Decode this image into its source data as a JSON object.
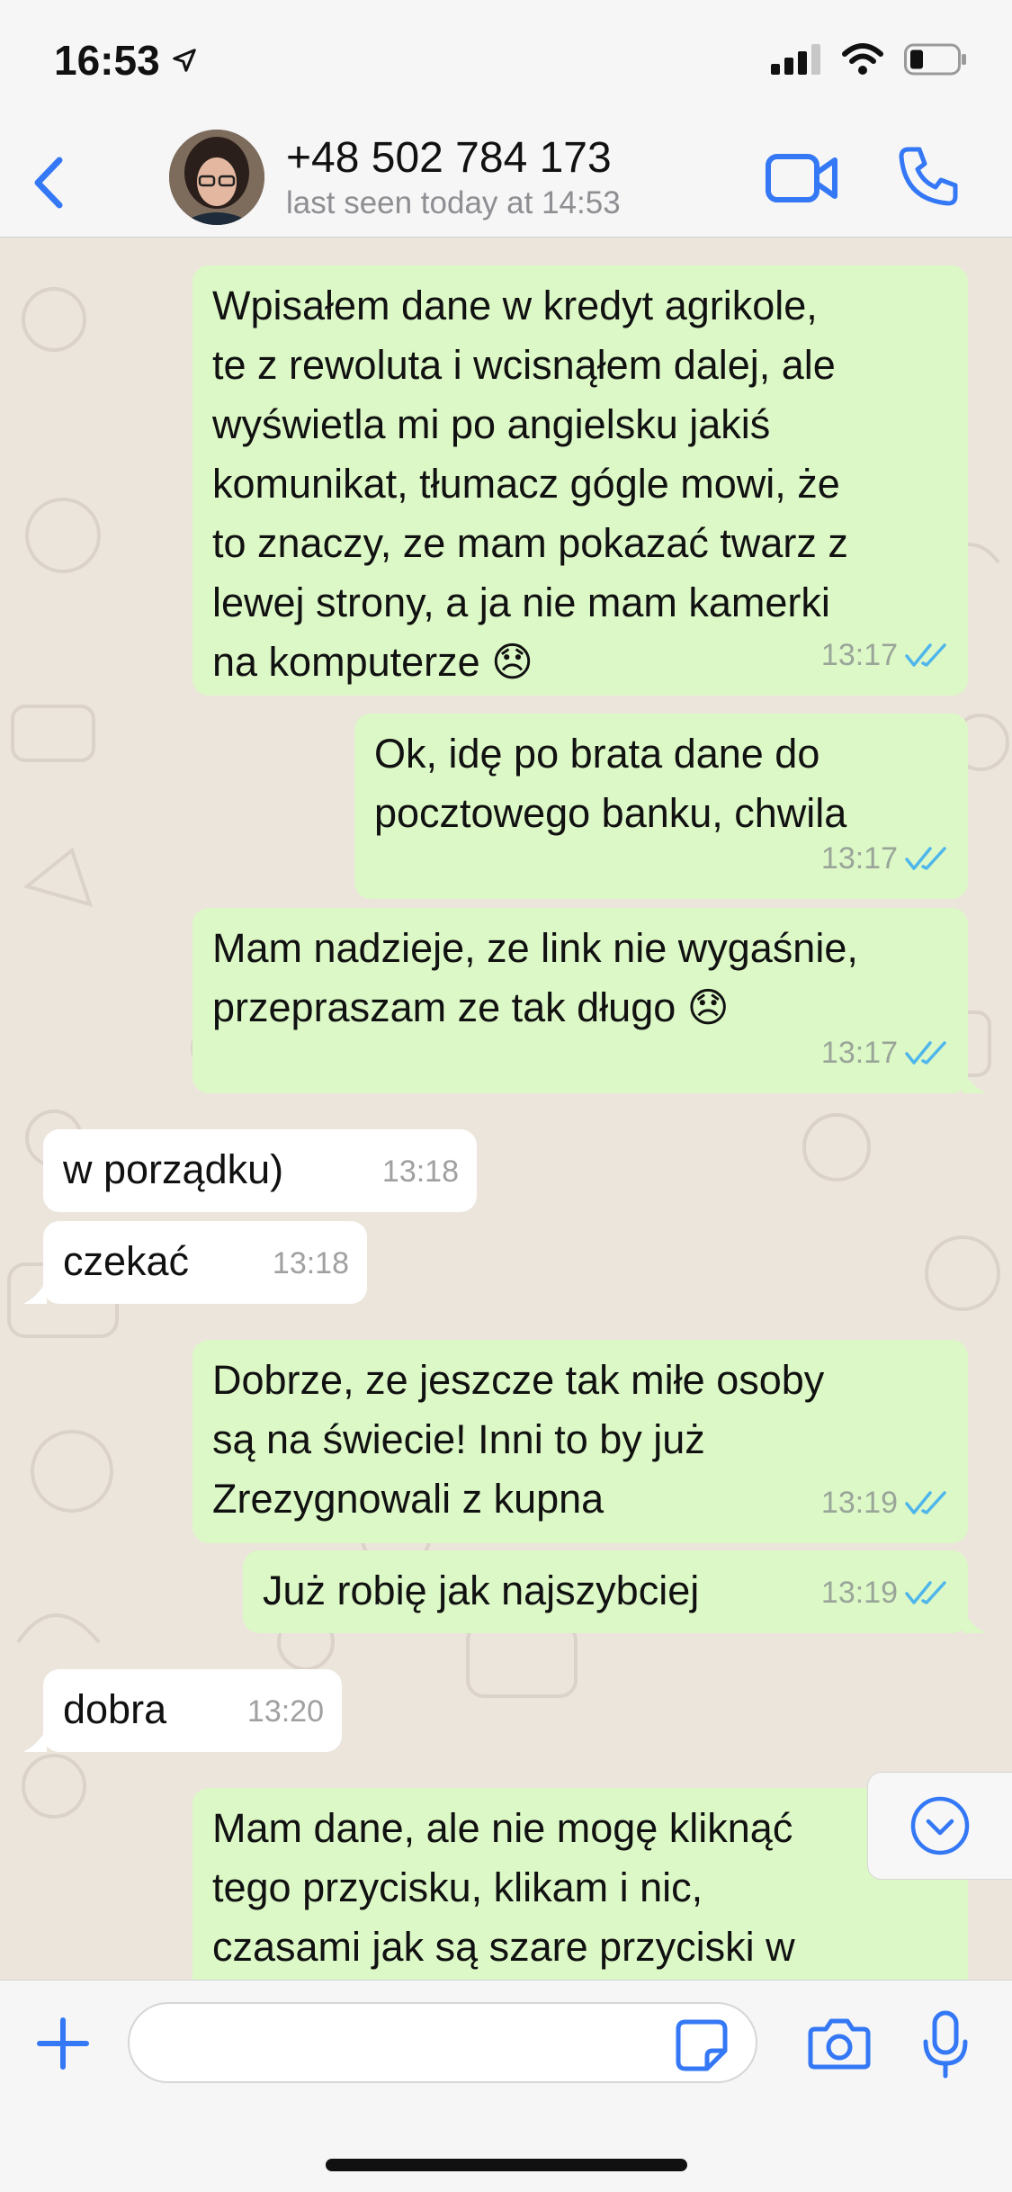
{
  "status_bar": {
    "time": "16:53",
    "icons": [
      "location-arrow-icon",
      "signal-icon",
      "wifi-icon",
      "battery-icon"
    ]
  },
  "header": {
    "contact_name": "+48 502 784 173",
    "last_seen": "last seen today at 14:53",
    "icons": [
      "back-chevron-icon",
      "video-call-icon",
      "phone-call-icon"
    ]
  },
  "messages": [
    {
      "direction": "out",
      "text": "Wpisałem dane w kredyt agrikole,\nte z rewoluta i wcisnąłem dalej, ale\nwyświetla mi po angielsku jakiś\nkomunikat, tłumacz gógle mowi, że\nto znaczy, ze mam pokazać twarz z\nlewej strony, a ja nie mam kamerki\nna komputerze 😞",
      "time": "13:17",
      "read": true
    },
    {
      "direction": "out",
      "text": "Ok, idę po brata dane do\npocztowego banku, chwila",
      "time": "13:17",
      "read": true
    },
    {
      "direction": "out",
      "text": "Mam nadzieje, ze link nie wygaśnie,\nprzepraszam ze tak długo 😞",
      "time": "13:17",
      "read": true
    },
    {
      "direction": "in",
      "text": "w porządku)",
      "time": "13:18"
    },
    {
      "direction": "in",
      "text": "czekać",
      "time": "13:18"
    },
    {
      "direction": "out",
      "text": "Dobrze, ze jeszcze tak miłe osoby\nsą na świecie! Inni to by już\nZrezygnowali z kupna",
      "time": "13:19",
      "read": true
    },
    {
      "direction": "out",
      "text": "Już robię jak najszybciej",
      "time": "13:19",
      "read": true
    },
    {
      "direction": "in",
      "text": "dobra",
      "time": "13:20"
    },
    {
      "direction": "out",
      "text": "Mam dane, ale nie mogę kliknąć\ntego przycisku, klikam i nic,\nczasami jak są szare przyciski w",
      "time": "",
      "read": false
    }
  ],
  "input_bar": {
    "placeholder": "",
    "icons": [
      "plus-icon",
      "sticker-icon",
      "camera-icon",
      "microphone-icon"
    ]
  },
  "colors": {
    "accent": "#3478f6",
    "outgoing_bubble": "#dcf8c6",
    "incoming_bubble": "#ffffff",
    "chat_background": "#ece5dc",
    "read_ticks": "#4fb6ec"
  }
}
